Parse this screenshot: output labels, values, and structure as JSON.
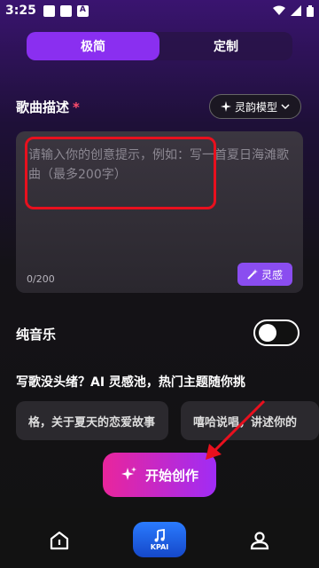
{
  "status_bar": {
    "time": "3:25"
  },
  "tabs": [
    {
      "label": "极简",
      "active": true
    },
    {
      "label": "定制",
      "active": false
    }
  ],
  "song_description": {
    "title": "歌曲描述",
    "required_mark": "*",
    "model_button": "灵韵模型",
    "placeholder": "请输入你的创意提示，例如：写一首夏日海滩歌曲（最多200字）",
    "char_count": "0/200",
    "inspire_button": "灵感"
  },
  "pure_music": {
    "label": "纯音乐",
    "enabled": false
  },
  "inspiration": {
    "title": "写歌没头绪？AI 灵感池，热门主题随你挑",
    "chips": [
      "格，关于夏天的恋爱故事",
      "嘻哈说唱，讲述你的"
    ]
  },
  "create_button": "开始创作",
  "bottom_nav": {
    "kpai_label": "KPAI"
  },
  "colors": {
    "accent": "#8a2ff0",
    "create_gradient_start": "#e9259c",
    "create_gradient_end": "#a02cf5",
    "highlight_red": "#e8101e"
  }
}
